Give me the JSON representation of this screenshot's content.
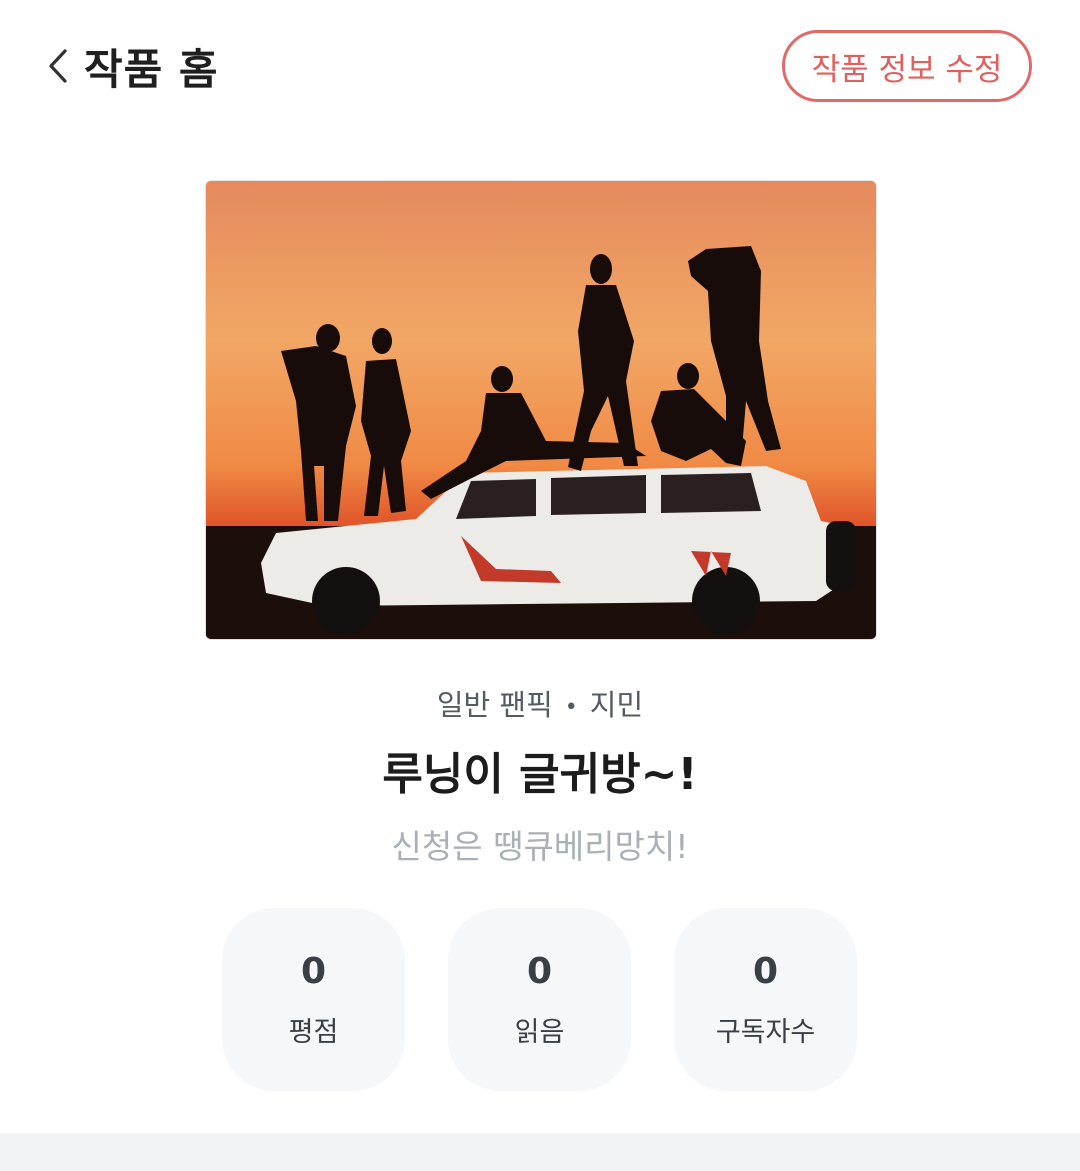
{
  "header": {
    "back_icon": "chevron-left-icon",
    "title": "작품 홈",
    "edit_label": "작품 정보 수정",
    "accent_color": "#e0605f"
  },
  "work": {
    "category": "일반 팬픽",
    "separator": "•",
    "character": "지민",
    "title": "루닝이 글귀방~!",
    "description": "신청은 땡큐베리망치!"
  },
  "stats": [
    {
      "value": "0",
      "label": "평점"
    },
    {
      "value": "0",
      "label": "읽음"
    },
    {
      "value": "0",
      "label": "구독자수"
    }
  ]
}
